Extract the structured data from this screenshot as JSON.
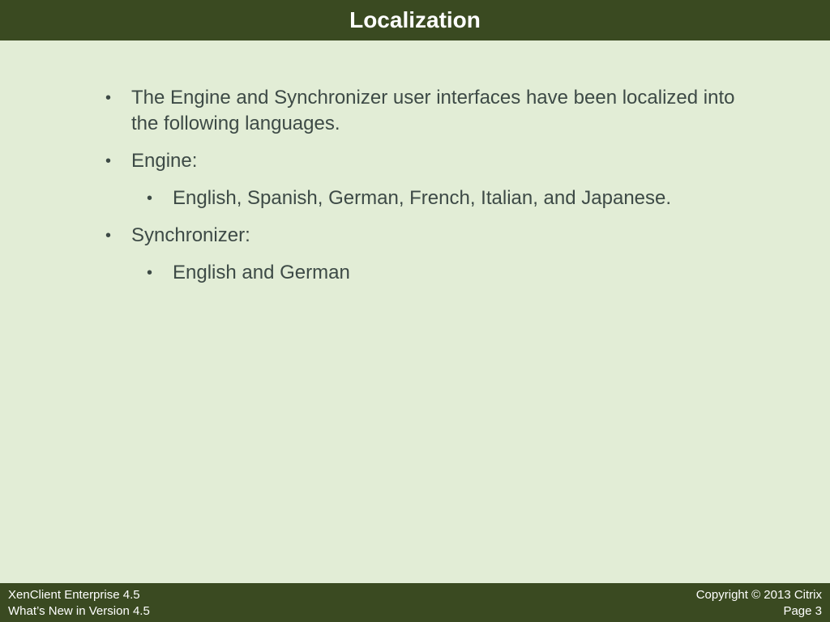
{
  "slide": {
    "title": "Localization"
  },
  "content": {
    "items": [
      {
        "level": 1,
        "text": "The Engine and Synchronizer user interfaces have been localized into the following languages."
      },
      {
        "level": 1,
        "text": "Engine:"
      },
      {
        "level": 2,
        "text": "English, Spanish, German, French, Italian, and Japanese."
      },
      {
        "level": 1,
        "text": "Synchronizer:"
      },
      {
        "level": 2,
        "text": "English and German"
      }
    ],
    "bullet_glyph": "•"
  },
  "footer": {
    "left_line1": "XenClient Enterprise 4.5",
    "left_line2": "What’s New in Version 4.5",
    "right_line1": "Copyright © 2013 Citrix",
    "right_line2": "Page 3"
  },
  "colors": {
    "header_bg": "#3a4a21",
    "slide_bg": "#e2edd6",
    "text": "#3d4a46"
  }
}
